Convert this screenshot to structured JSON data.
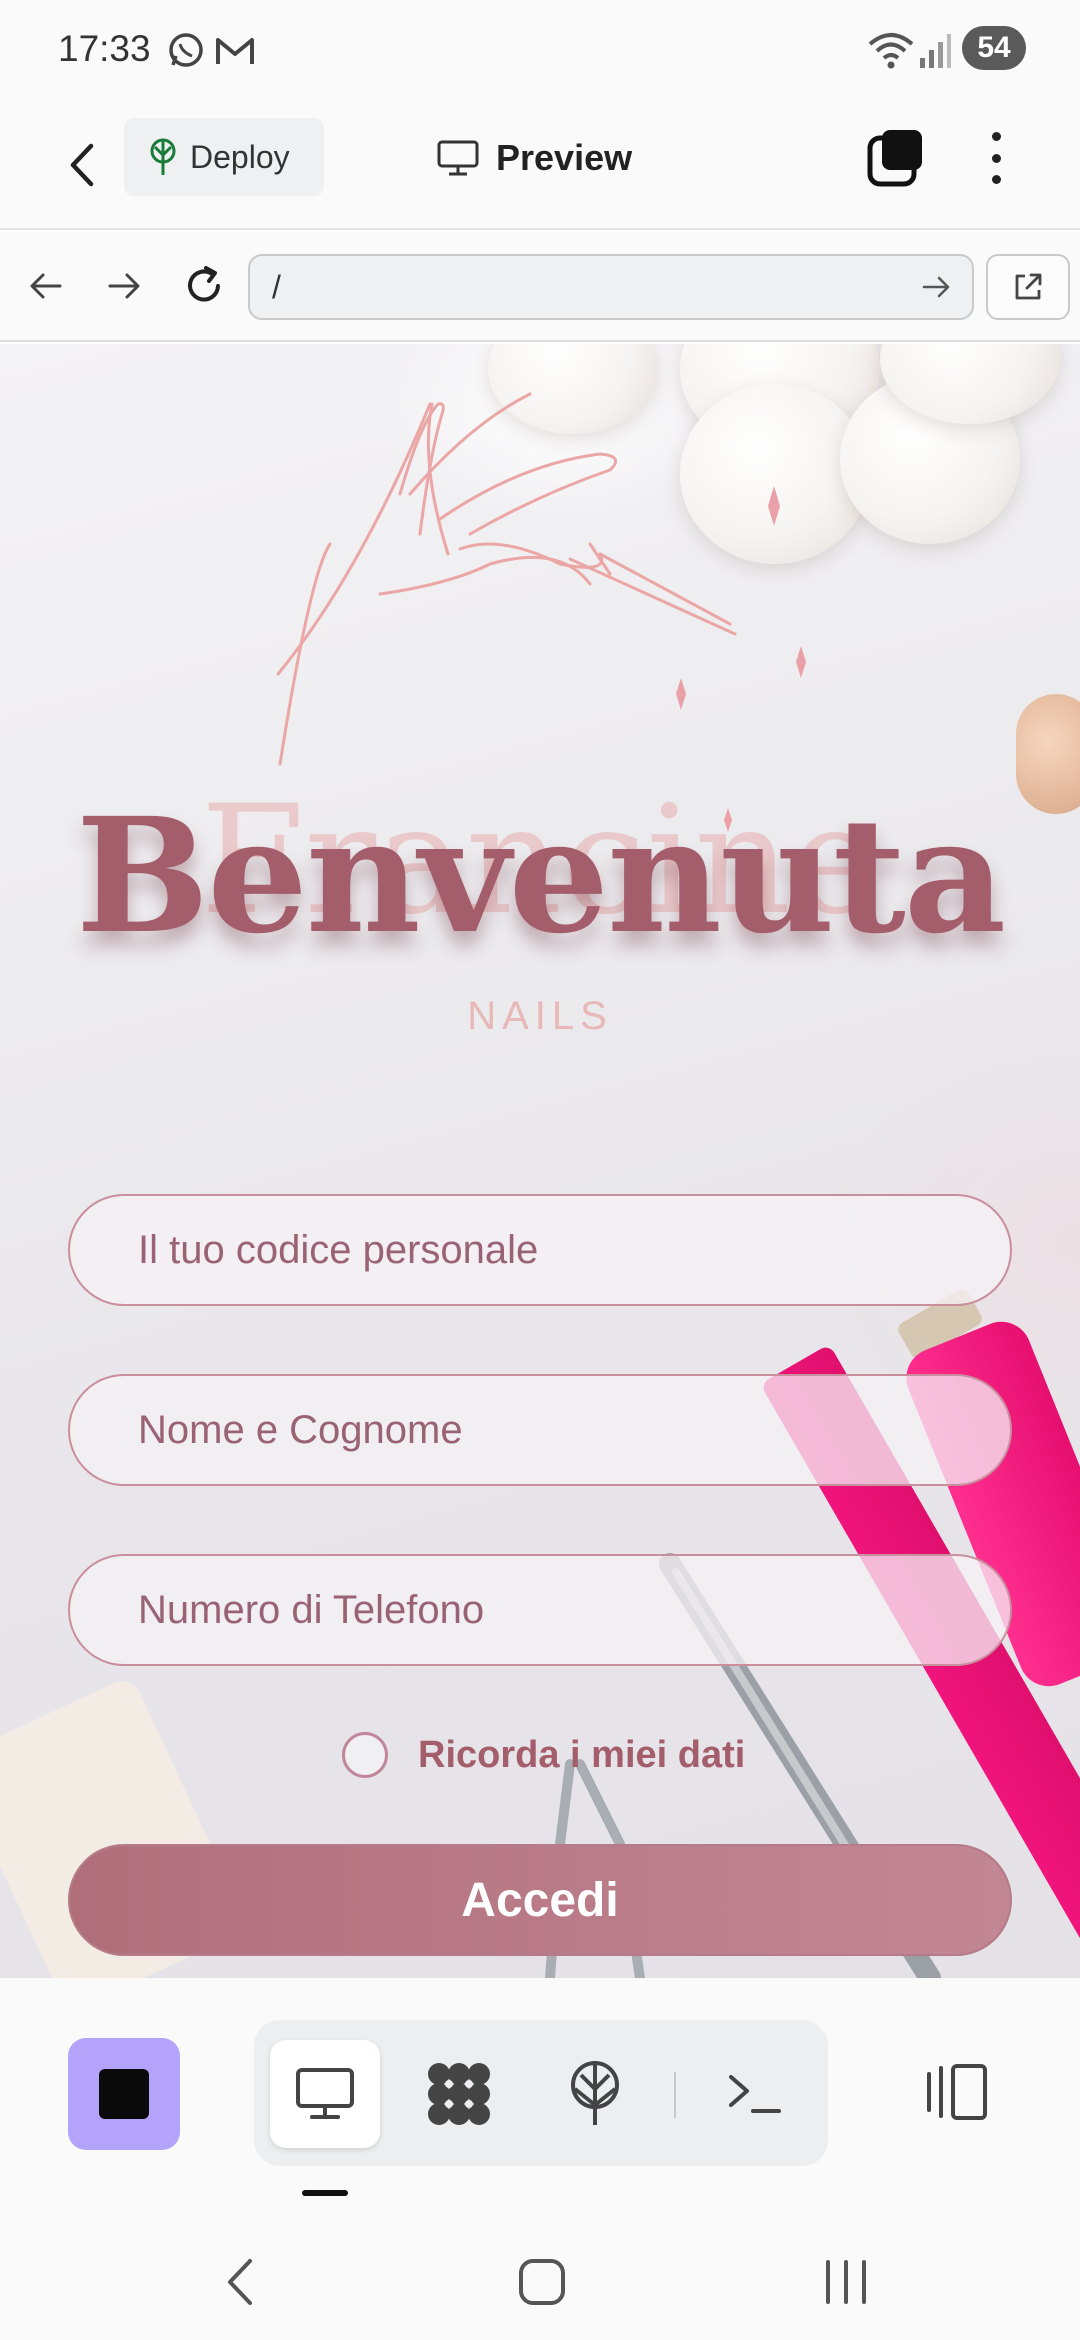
{
  "status_bar": {
    "time": "17:33",
    "battery": "54",
    "icons": [
      "whatsapp-icon",
      "gmail-icon",
      "wifi-icon",
      "signal-icon"
    ]
  },
  "header": {
    "deploy_label": "Deploy",
    "preview_label": "Preview",
    "icons": [
      "back-arrow-icon",
      "deploy-tree-icon",
      "monitor-icon",
      "tabs-icon",
      "more-vertical-icon"
    ]
  },
  "browser": {
    "url": "/",
    "icons": [
      "back-icon",
      "forward-icon",
      "reload-icon",
      "go-arrow-icon",
      "open-external-icon"
    ]
  },
  "page": {
    "title": "Benvenuta",
    "brand_ghost": "Francine",
    "brand_sub": "NAILS",
    "code_placeholder": "Il tuo codice personale",
    "name_placeholder": "Nome e Cognome",
    "phone_placeholder": "Numero di Telefono",
    "remember_label": "Ricorda i miei dati",
    "submit_label": "Accedi",
    "colors": {
      "accent": "#a35d6b",
      "field_border": "#c98f9d",
      "button": "#b8747f"
    }
  },
  "toolbar": {
    "stop_color": "#b4a3fb",
    "tools": [
      "preview-monitor-icon",
      "apps-grid-icon",
      "deploy-tree-icon",
      "terminal-icon"
    ],
    "active_tool": "preview-monitor-icon"
  },
  "android_nav": [
    "back-nav-icon",
    "home-nav-icon",
    "recents-nav-icon"
  ]
}
